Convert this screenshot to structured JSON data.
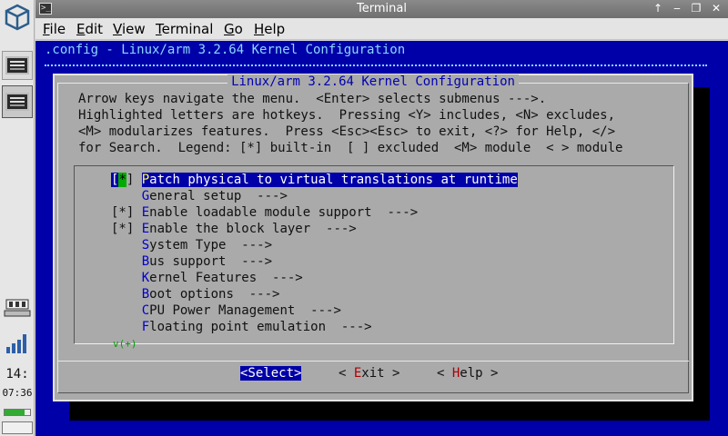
{
  "window": {
    "title": "Terminal",
    "buttons": [
      "↑",
      "‒",
      "❐",
      "✕"
    ]
  },
  "menubar": {
    "items": [
      {
        "ul": "F",
        "rest": "ile"
      },
      {
        "ul": "E",
        "rest": "dit"
      },
      {
        "ul": "V",
        "rest": "iew"
      },
      {
        "ul": "T",
        "rest": "erminal"
      },
      {
        "ul": "G",
        "rest": "o"
      },
      {
        "ul": "H",
        "rest": "elp"
      }
    ]
  },
  "panel": {
    "clock_hour": "14:",
    "clock_min": "07:36",
    "battery_level": 0.8
  },
  "terminal": {
    "header": ".config - Linux/arm 3.2.64 Kernel Configuration",
    "dialog_title": "Linux/arm 3.2.64 Kernel Configuration",
    "help": [
      "Arrow keys navigate the menu.  <Enter> selects submenus --->.",
      "Highlighted letters are hotkeys.  Pressing <Y> includes, <N> excludes,",
      "<M> modularizes features.  Press <Esc><Esc> to exit, <?> for Help, </>",
      "for Search.  Legend: [*] built-in  [ ] excluded  <M> module  < > module"
    ],
    "menu": [
      {
        "prefix_open": "[",
        "mark": "*",
        "prefix_close": "] ",
        "hotkey": "P",
        "rest": "atch physical to virtual translations at runtime",
        "selected": true
      },
      {
        "prefix": "    ",
        "hotkey": "G",
        "rest": "eneral setup  --->"
      },
      {
        "prefix": "[*] ",
        "hotkey": "E",
        "rest": "nable loadable module support  --->"
      },
      {
        "prefix": "[*] ",
        "hotkey": "E",
        "rest": "nable the block layer  --->"
      },
      {
        "prefix": "    ",
        "hotkey": "S",
        "rest": "ystem Type  --->"
      },
      {
        "prefix": "    ",
        "hotkey": "B",
        "rest": "us support  --->"
      },
      {
        "prefix": "    ",
        "hotkey": "K",
        "rest": "ernel Features  --->"
      },
      {
        "prefix": "    ",
        "hotkey": "B",
        "rest": "oot options  --->"
      },
      {
        "prefix": "    ",
        "hotkey": "C",
        "rest": "PU Power Management  --->"
      },
      {
        "prefix": "    ",
        "hotkey": "F",
        "rest": "loating point emulation  --->"
      }
    ],
    "more_indicator": "v(+)",
    "buttons": {
      "select": "<Select>",
      "exit_open": "< ",
      "exit_hk": "E",
      "exit_rest": "xit >",
      "help_open": "< ",
      "help_hk": "H",
      "help_rest": "elp >"
    }
  }
}
